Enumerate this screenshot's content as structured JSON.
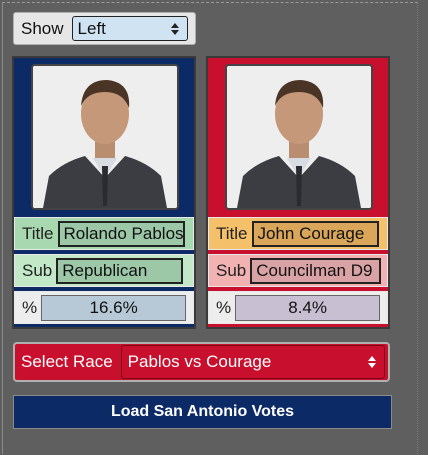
{
  "show": {
    "label": "Show",
    "selected": "Left"
  },
  "candidates": [
    {
      "title_label": "Title",
      "title_value": "Rolando Pablos",
      "sub_label": "Sub",
      "sub_value": "Republican",
      "pct_label": "%",
      "pct_value": "16.6%",
      "colors": {
        "panel": "#0c2a66",
        "title_bg": "#a8d8b0",
        "title_input": "#9cc8a8",
        "sub_bg": "#c2e8c8",
        "sub_input": "#9cc8a8",
        "pct_bg": "#ededed",
        "pct_input": "#b7c9d7"
      }
    },
    {
      "title_label": "Title",
      "title_value": "John Courage",
      "sub_label": "Sub",
      "sub_value": "Councilman D9",
      "pct_label": "%",
      "pct_value": "8.4%",
      "colors": {
        "panel": "#c8102e",
        "title_bg": "#f5c06a",
        "title_input": "#d9a65a",
        "sub_bg": "#f2b2b2",
        "sub_input": "#d9a3a6",
        "pct_bg": "#ededed",
        "pct_input": "#c9bfd2"
      }
    }
  ],
  "race": {
    "label": "Select Race",
    "selected": "Pablos vs Courage"
  },
  "load_button": {
    "label": "Load San Antonio Votes"
  },
  "icons": {
    "photo": "person-photo-icon",
    "select_arrows": "select-arrows-icon"
  }
}
